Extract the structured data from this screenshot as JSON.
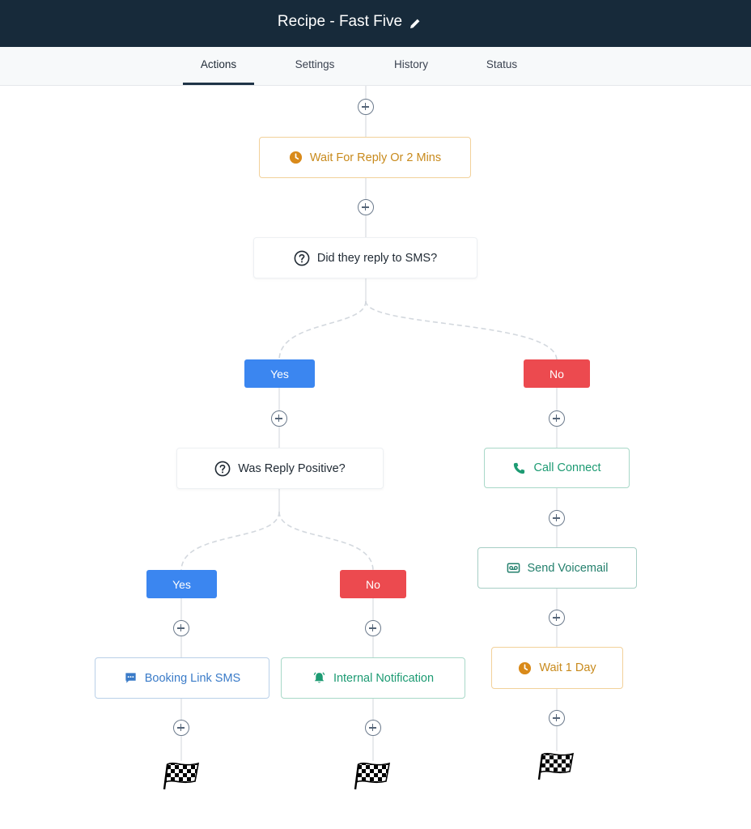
{
  "header": {
    "title": "Recipe - Fast Five",
    "edit_icon": "pencil-icon"
  },
  "tabs": [
    {
      "label": "Actions",
      "active": true
    },
    {
      "label": "Settings",
      "active": false
    },
    {
      "label": "History",
      "active": false
    },
    {
      "label": "Status",
      "active": false
    }
  ],
  "workflow": {
    "wait_reply": {
      "label": "Wait For Reply Or 2 Mins",
      "icon": "clock-icon"
    },
    "condition_sms": {
      "label": "Did they reply to SMS?",
      "icon": "question-icon"
    },
    "branch_yes": "Yes",
    "branch_no": "No",
    "condition_positive": {
      "label": "Was Reply Positive?",
      "icon": "question-icon"
    },
    "sub_yes": "Yes",
    "sub_no": "No",
    "booking_sms": {
      "label": "Booking Link SMS",
      "icon": "chat-icon"
    },
    "internal_notification": {
      "label": "Internal Notification",
      "icon": "bell-icon"
    },
    "call_connect": {
      "label": "Call Connect",
      "icon": "phone-icon"
    },
    "send_voicemail": {
      "label": "Send Voicemail",
      "icon": "voicemail-icon"
    },
    "wait_day": {
      "label": "Wait 1 Day",
      "icon": "clock-icon"
    },
    "end_marker_icon": "checkered-flag-icon"
  },
  "colors": {
    "header_bg": "#172a3a",
    "yes": "#3b86f0",
    "no": "#ec4a4f",
    "wait": "#c88a1c",
    "call": "#1d9b73",
    "voicemail": "#24806d",
    "sms": "#3a7bc8"
  }
}
